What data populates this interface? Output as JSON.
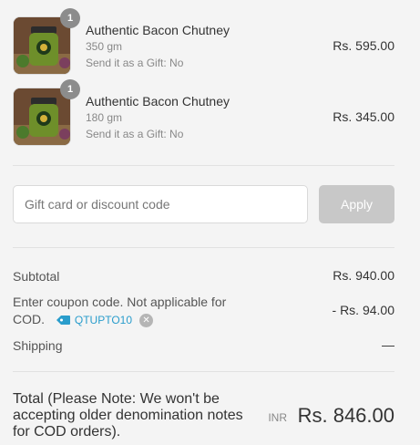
{
  "items": [
    {
      "quantity": "1",
      "name": "Authentic Bacon Chutney",
      "variant": "350 gm",
      "gift_note": "Send it as a Gift: No",
      "price": "Rs. 595.00",
      "thumbnail_icon": "chutney-jar-image"
    },
    {
      "quantity": "1",
      "name": "Authentic Bacon Chutney",
      "variant": "180 gm",
      "gift_note": "Send it as a Gift: No",
      "price": "Rs. 345.00",
      "thumbnail_icon": "chutney-jar-image"
    }
  ],
  "discount": {
    "placeholder": "Gift card or discount code",
    "apply_label": "Apply"
  },
  "summary": {
    "subtotal_label": "Subtotal",
    "subtotal_value": "Rs. 940.00",
    "coupon_label_line1": "Enter coupon code. Not applicable for",
    "coupon_label_line2": "COD.",
    "coupon_code": "QTUPTO10",
    "coupon_value": "- Rs. 94.00",
    "shipping_label": "Shipping",
    "shipping_value": "—"
  },
  "total": {
    "label": "Total (Please Note: We won't be accepting older denomination notes for COD orders).",
    "currency": "INR",
    "value": "Rs. 846.00"
  },
  "colors": {
    "background": "#f4f4f4",
    "coupon_accent": "#2a9dcc",
    "apply_disabled": "#c8c8c8"
  }
}
